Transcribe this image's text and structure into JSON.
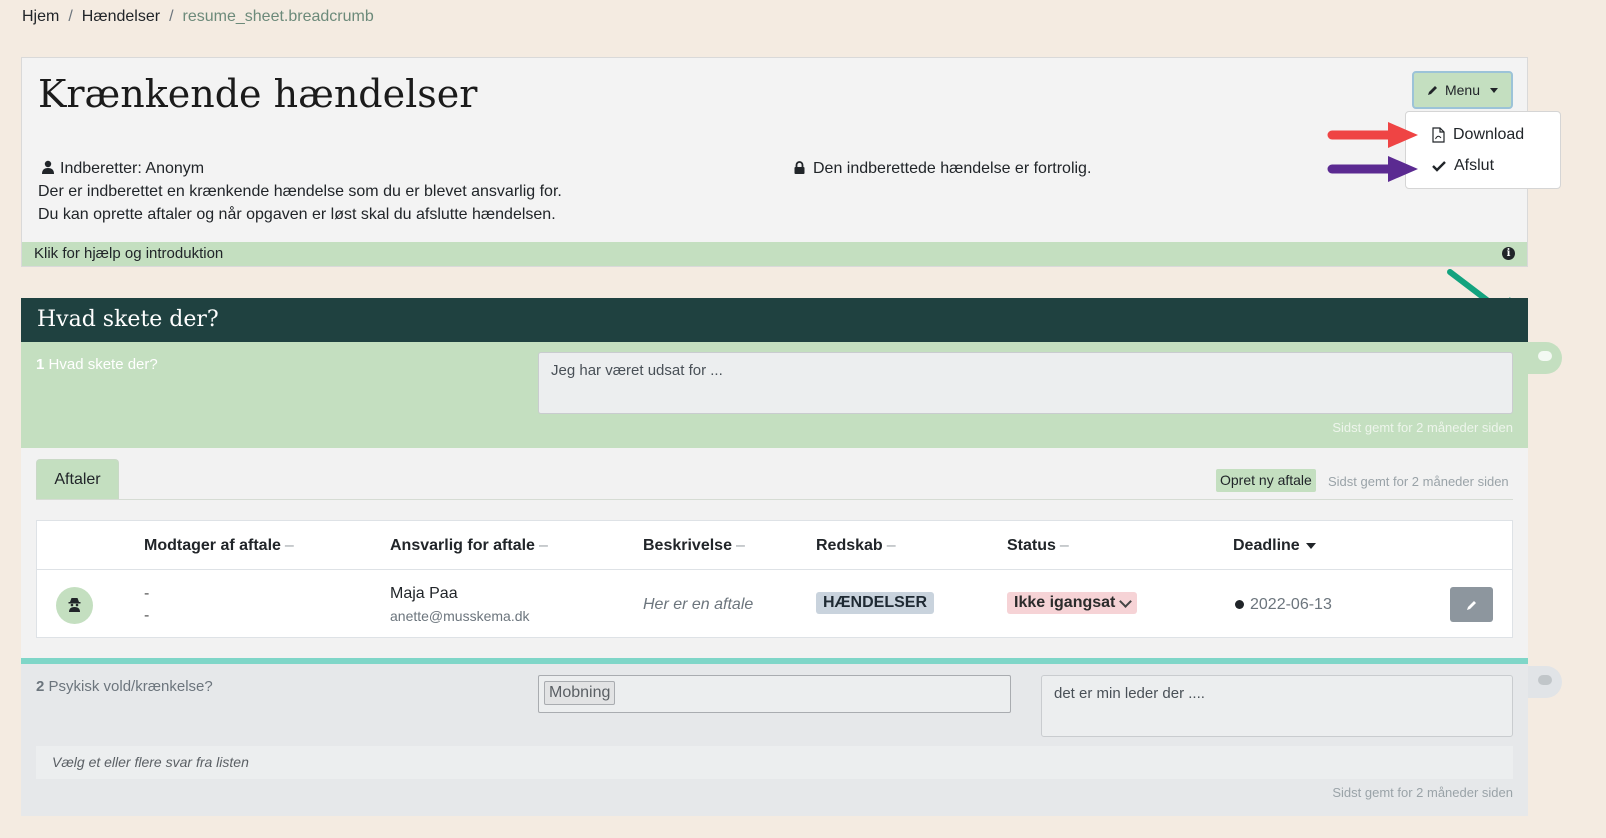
{
  "breadcrumb": {
    "home": "Hjem",
    "events": "Hændelser",
    "current": "resume_sheet.breadcrumb"
  },
  "header": {
    "title": "Krænkende hændelser",
    "reporter": "Indberetter: Anonym",
    "confidential": "Den indberettede hændelse er fortrolig.",
    "desc1": "Der er indberettet en krænkende hændelse som du er blevet ansvarlig for.",
    "desc2": "Du kan oprette aftaler og når opgaven er løst skal du afslutte hændelsen.",
    "help": "Klik for hjælp og introduktion"
  },
  "menu": {
    "label": "Menu",
    "items": [
      {
        "label": "Download"
      },
      {
        "label": "Afslut"
      }
    ]
  },
  "section": {
    "title": "Hvad skete der?"
  },
  "q1": {
    "number": "1",
    "label": "Hvad skete der?",
    "answer": "Jeg har været udsat for ...",
    "saved": "Sidst gemt for 2 måneder siden"
  },
  "agreements": {
    "tab": "Aftaler",
    "create": "Opret ny aftale",
    "saved": "Sidst gemt for 2 måneder siden",
    "columns": [
      "Modtager af aftale",
      "Ansvarlig for aftale",
      "Beskrivelse",
      "Redskab",
      "Status",
      "Deadline"
    ],
    "column_dash": "–",
    "row": {
      "recipient_line1": "-",
      "recipient_line2": "-",
      "responsible_name": "Maja Paa",
      "responsible_email": "anette@musskema.dk",
      "description": "Her er en aftale",
      "tool": "HÆNDELSER",
      "status": "Ikke igangsat",
      "deadline": "2022-06-13"
    }
  },
  "q2": {
    "number": "2",
    "label": "Psykisk vold/krænkelse?",
    "chip": "Mobning",
    "comment": "det er min leder der ....",
    "hint": "Vælg et eller flere svar fra listen",
    "saved": "Sidst gemt for 2 måneder siden"
  },
  "colors": {
    "accent_green": "#c4dfc0",
    "dark_header": "#1f4140",
    "teal": "#7fd6c8",
    "arrow_red": "#ef4444",
    "arrow_purple": "#5b2a91",
    "arrow_teal": "#13a37f",
    "arrow_orange": "#f5a623"
  }
}
